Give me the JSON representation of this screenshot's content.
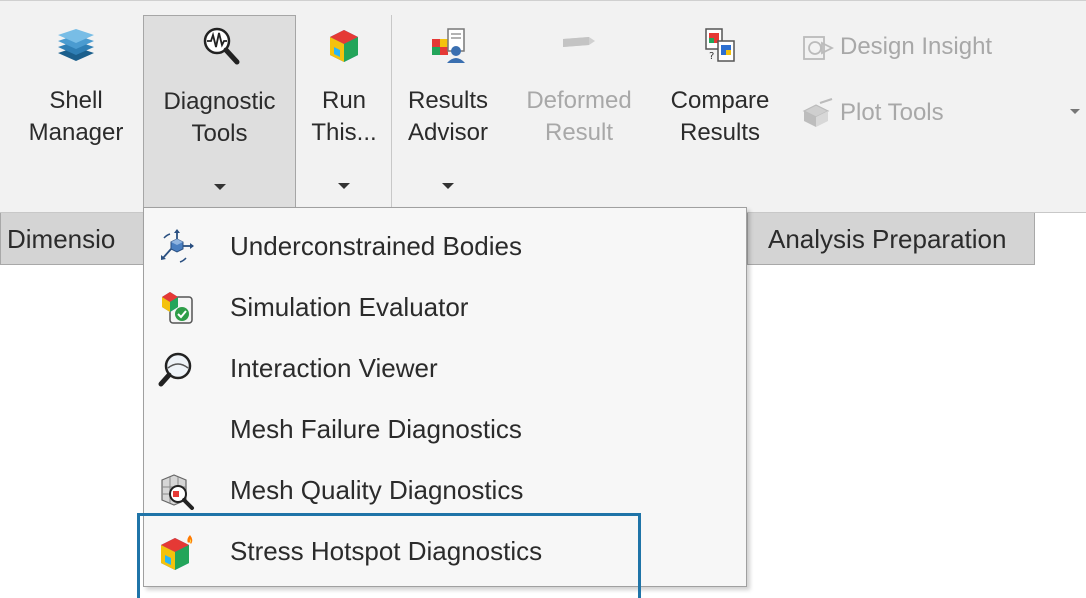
{
  "ribbon": {
    "buttons": [
      {
        "id": "shell-manager",
        "line1": "Shell",
        "line2": "Manager",
        "icon": "stacked-layers-icon"
      },
      {
        "id": "diagnostic-tools",
        "line1": "Diagnostic",
        "line2": "Tools",
        "icon": "magnifier-waveform-icon"
      },
      {
        "id": "run-this",
        "line1": "Run",
        "line2": "This...",
        "icon": "colored-part-icon"
      },
      {
        "id": "results-advisor",
        "line1": "Results",
        "line2": "Advisor",
        "icon": "advisor-person-icon"
      },
      {
        "id": "deformed-result",
        "line1": "Deformed",
        "line2": "Result",
        "icon": "deformed-shape-icon"
      },
      {
        "id": "compare-results",
        "line1": "Compare",
        "line2": "Results",
        "icon": "compare-windows-icon"
      }
    ],
    "design_insight": "Design Insight",
    "plot_tools": "Plot Tools"
  },
  "tabs": {
    "left_partial": "Dimensio",
    "analysis_preparation": "Analysis Preparation"
  },
  "menu": {
    "items": [
      {
        "label": "Underconstrained Bodies",
        "icon": "axes-cube-icon"
      },
      {
        "label": "Simulation Evaluator",
        "icon": "evaluator-check-icon"
      },
      {
        "label": "Interaction Viewer",
        "icon": "magnifier-lens-icon"
      },
      {
        "label": "Mesh Failure Diagnostics",
        "icon": ""
      },
      {
        "label": "Mesh Quality Diagnostics",
        "icon": "mesh-magnifier-icon"
      },
      {
        "label": "Stress Hotspot Diagnostics",
        "icon": "hotspot-part-icon"
      }
    ]
  },
  "colors": {
    "highlight_border": "#1f74a8",
    "ribbon_bg": "#f2f2f2",
    "menu_bg": "#f7f7f7",
    "disabled_text": "#a8a8a8"
  }
}
